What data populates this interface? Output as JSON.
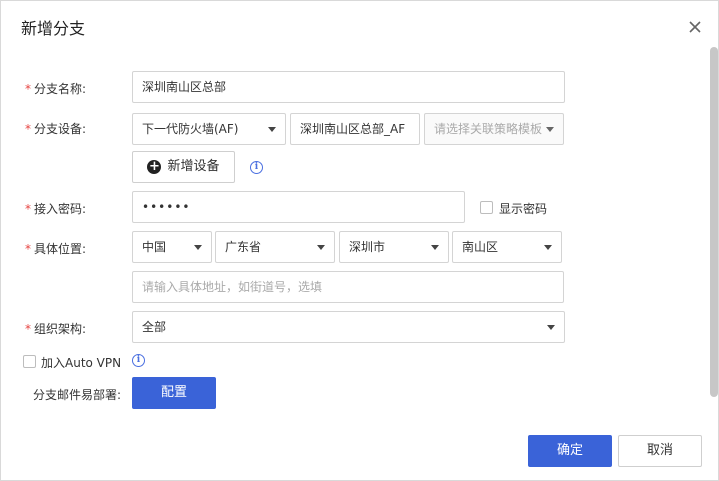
{
  "dialog": {
    "title": "新增分支"
  },
  "form": {
    "required_mark": "*",
    "branch_name": {
      "label": "分支名称:",
      "value": "深圳南山区总部"
    },
    "branch_device": {
      "label": "分支设备:",
      "device_type": "下一代防火墙(AF)",
      "device_name": "深圳南山区总部_AF",
      "policy_template_placeholder": "请选择关联策略模板"
    },
    "add_device_label": "新增设备",
    "access_password": {
      "label": "接入密码:",
      "value": "••••••",
      "show_password_label": "显示密码"
    },
    "location": {
      "label": "具体位置:",
      "country": "中国",
      "province": "广东省",
      "city": "深圳市",
      "district": "南山区",
      "address_placeholder": "请输入具体地址，如街道号，选填"
    },
    "org": {
      "label": "组织架构:",
      "value": "全部"
    },
    "auto_vpn_label": "加入Auto VPN",
    "mail_deploy": {
      "label": "分支邮件易部署:",
      "button": "配置"
    }
  },
  "footer": {
    "confirm": "确定",
    "cancel": "取消"
  },
  "icons": {
    "info": "i",
    "plus": "+"
  }
}
